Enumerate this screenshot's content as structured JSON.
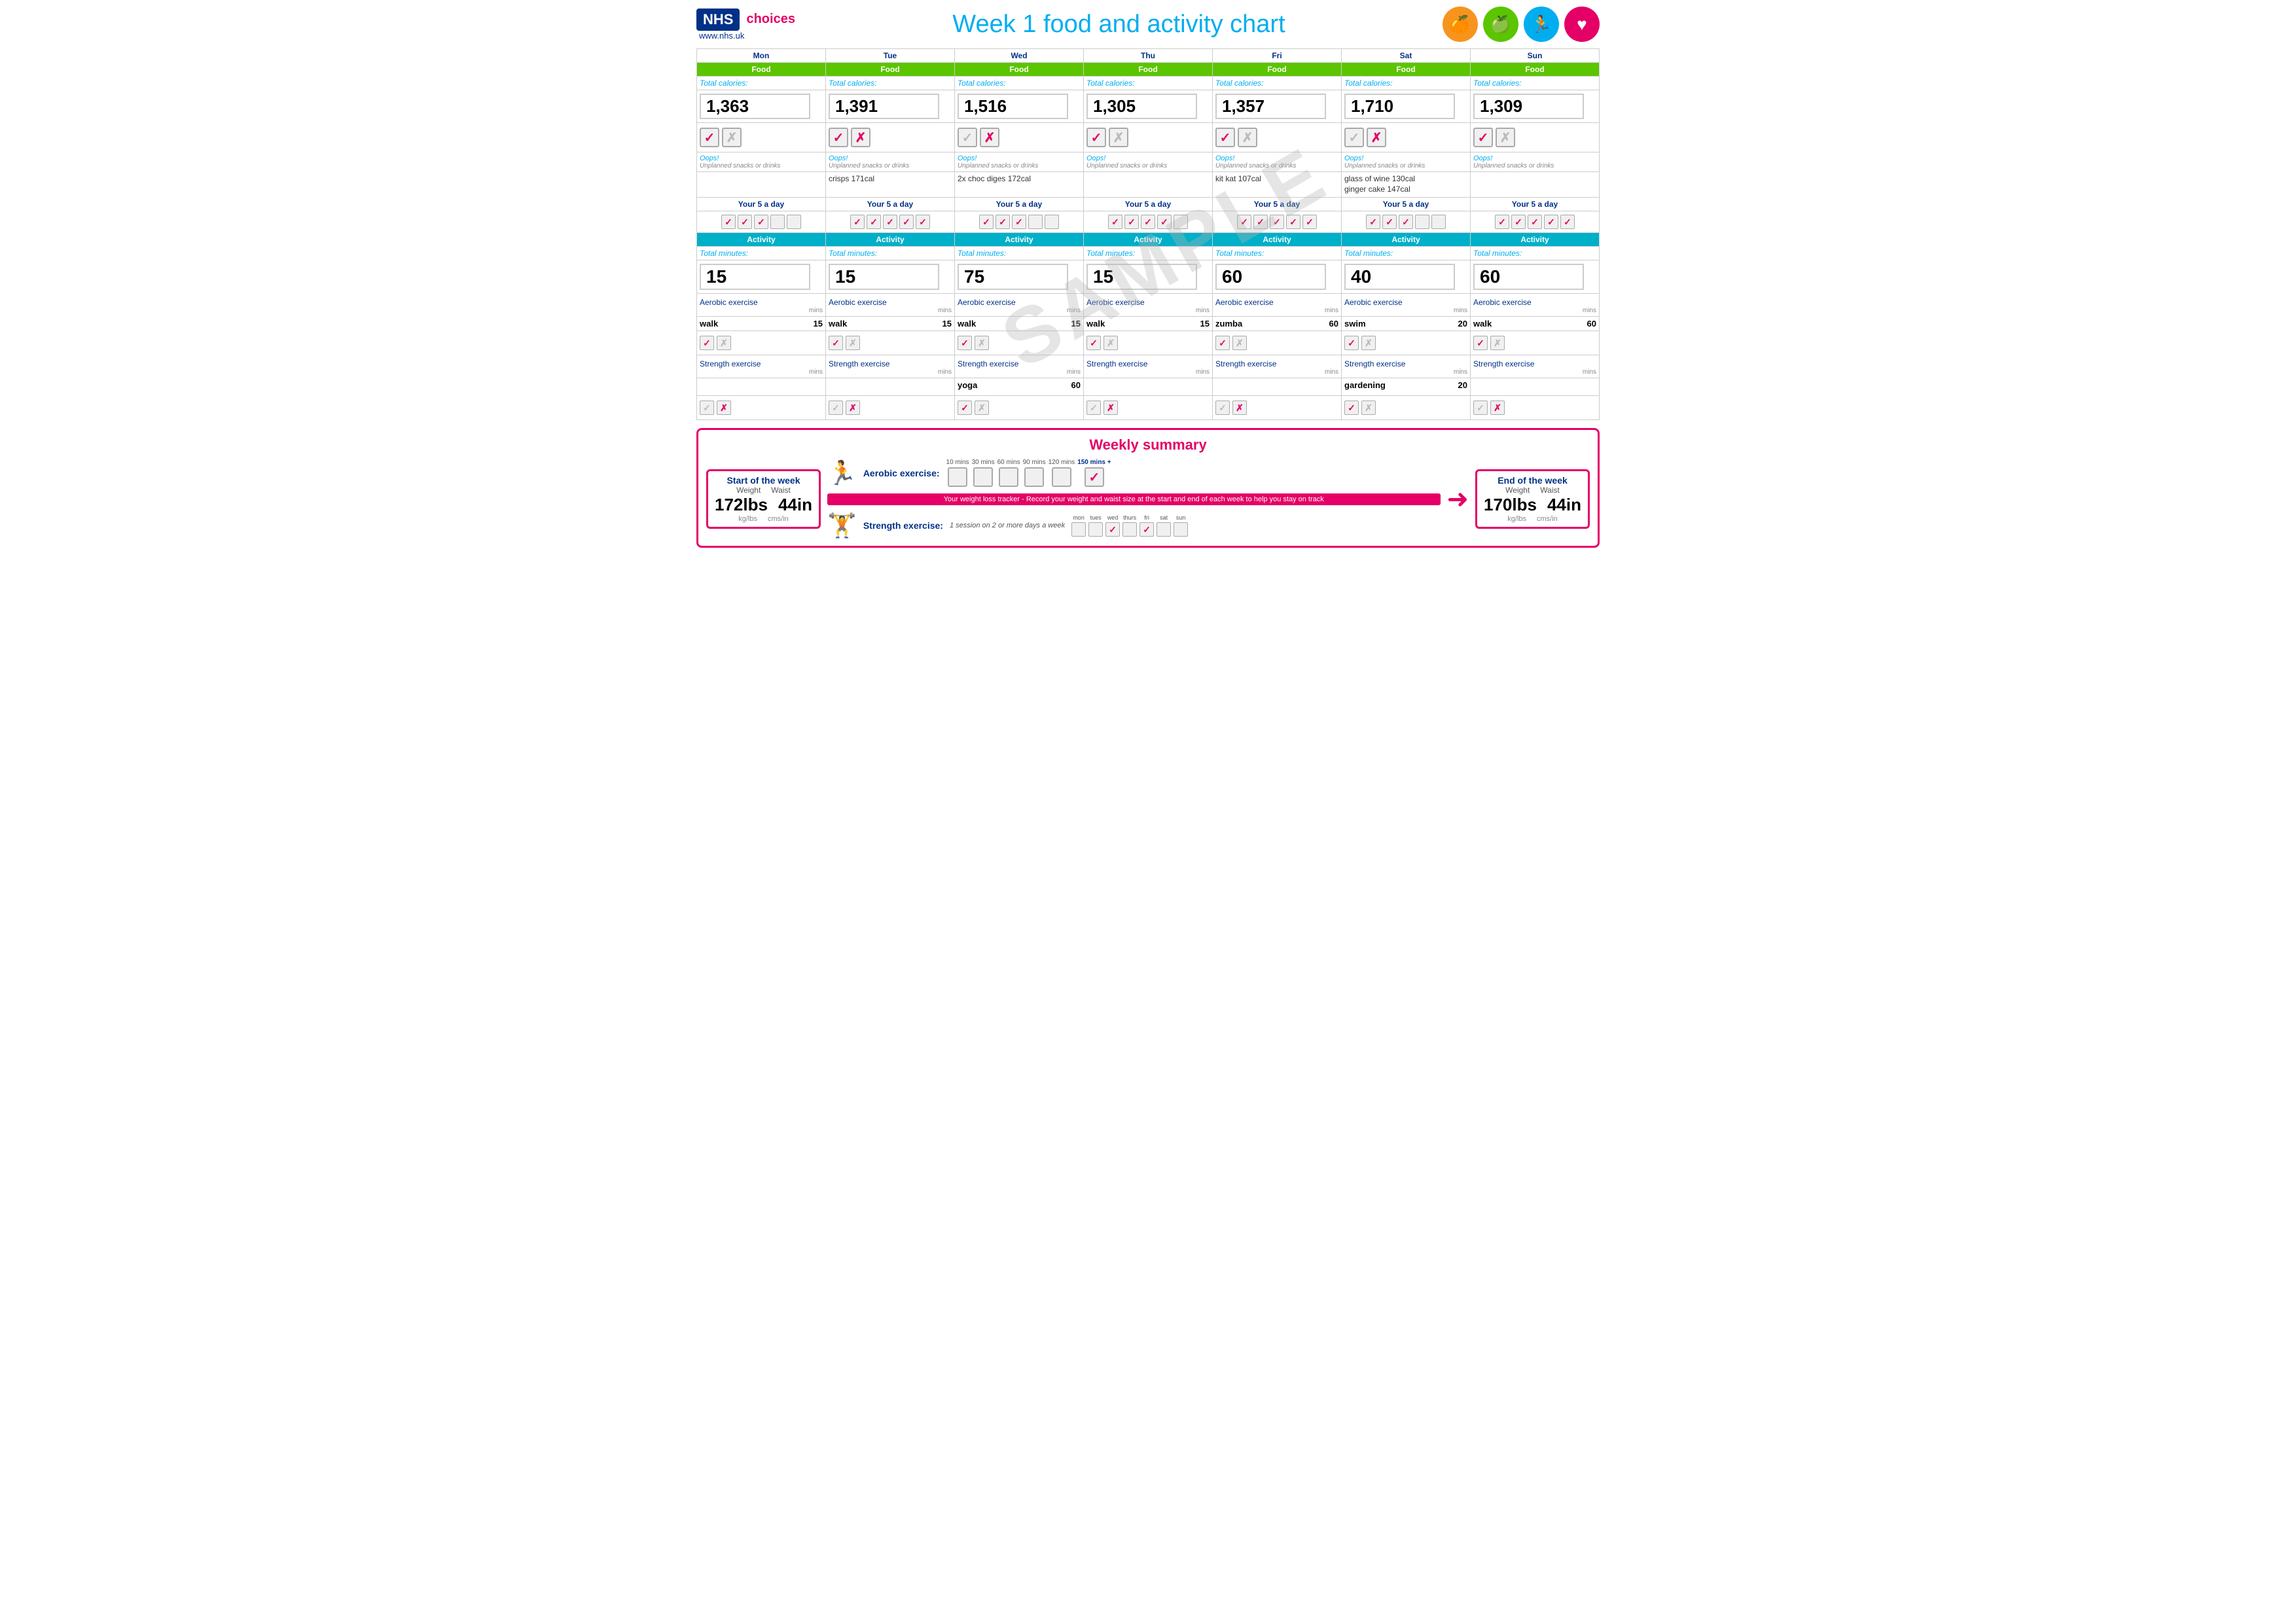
{
  "header": {
    "nhs": "NHS",
    "choices": "choices",
    "url": "www.nhs.uk",
    "title": "Week 1 food and activity chart",
    "icons": [
      {
        "name": "apple-icon",
        "color": "#f7941d",
        "symbol": "🍊"
      },
      {
        "name": "green-apple-icon",
        "color": "#5bc500",
        "symbol": "🍏"
      },
      {
        "name": "running-icon",
        "color": "#00aeef",
        "symbol": "🏃"
      },
      {
        "name": "heart-icon",
        "color": "#e40066",
        "symbol": "♥"
      }
    ]
  },
  "days": [
    "Mon",
    "Tue",
    "Wed",
    "Thu",
    "Fri",
    "Sat",
    "Sun"
  ],
  "food": {
    "label": "Food",
    "total_label": "Total calories:",
    "calories": [
      "1,363",
      "1,391",
      "1,516",
      "1,305",
      "1,357",
      "1,710",
      "1,309"
    ],
    "snack_label": "Oops!",
    "snack_sublabel": "Unplanned snacks or drinks",
    "snacks": [
      "",
      "crisps 171cal",
      "2x choc diges 172cal",
      "",
      "kit kat 107cal",
      "glass of wine 130cal\nginger cake 147cal",
      ""
    ],
    "five_label": "Your 5 a day",
    "five_checks": [
      [
        true,
        true,
        true,
        false,
        false
      ],
      [
        true,
        true,
        true,
        true,
        true
      ],
      [
        true,
        true,
        true,
        false,
        false
      ],
      [
        true,
        true,
        true,
        true,
        false
      ],
      [
        true,
        true,
        true,
        true,
        true
      ],
      [
        true,
        true,
        true,
        false,
        false
      ],
      [
        true,
        true,
        true,
        true,
        true
      ]
    ],
    "planned_checked": [
      true,
      true,
      false,
      true,
      true,
      false,
      true
    ],
    "planned_x": [
      false,
      true,
      true,
      false,
      false,
      true,
      false
    ]
  },
  "activity": {
    "label": "Activity",
    "total_label": "Total minutes:",
    "minutes": [
      "15",
      "15",
      "75",
      "15",
      "60",
      "40",
      "60"
    ],
    "aerobic_label": "Aerobic exercise",
    "aerobic_activity": [
      "walk",
      "walk",
      "walk",
      "walk",
      "zumba",
      "swim",
      "walk"
    ],
    "aerobic_mins": [
      "15",
      "15",
      "15",
      "15",
      "60",
      "20",
      "60"
    ],
    "aerobic_checked": [
      true,
      true,
      true,
      true,
      true,
      true,
      true
    ],
    "strength_label": "Strength exercise",
    "strength_activity": [
      "",
      "",
      "yoga",
      "",
      "",
      "gardening",
      ""
    ],
    "strength_mins": [
      "",
      "",
      "60",
      "",
      "",
      "20",
      ""
    ],
    "strength_checked1": [
      true,
      true,
      true,
      true,
      true,
      true,
      true
    ],
    "strength_checked2": [
      false,
      false,
      false,
      false,
      false,
      false,
      false
    ],
    "bottom_check1": [
      false,
      false,
      true,
      false,
      false,
      true,
      false
    ],
    "bottom_check2": [
      true,
      true,
      false,
      true,
      true,
      false,
      true
    ]
  },
  "summary": {
    "title": "Weekly summary",
    "start_title": "Start of the week",
    "end_title": "End of the week",
    "weight_label": "Weight",
    "waist_label": "Waist",
    "start_weight": "172lbs",
    "start_waist": "44in",
    "end_weight": "170lbs",
    "end_waist": "44in",
    "kg_lbs": "kg/lbs",
    "cms_in": "cms/in",
    "aerobic_label": "Aerobic exercise:",
    "aerobic_mins_labels": [
      "10 mins",
      "30 mins",
      "60 mins",
      "90 mins",
      "120 mins",
      "150 mins +"
    ],
    "aerobic_checked_idx": 5,
    "tracker_text": "Your weight loss tracker - Record your weight and waist size at the start and end of each week to help you stay on track",
    "strength_label": "Strength exercise:",
    "strength_session": "1 session on 2 or more days a week",
    "strength_days": [
      "mon",
      "tues",
      "wed",
      "thurs",
      "fri",
      "sat",
      "sun"
    ],
    "strength_checked": [
      false,
      false,
      true,
      false,
      true,
      false,
      false
    ]
  }
}
